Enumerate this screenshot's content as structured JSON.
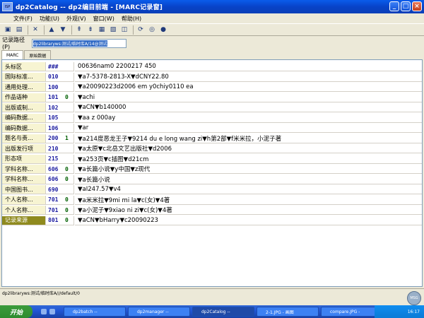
{
  "window": {
    "title": "dp2Catalog -- dp2编目前端 - [MARC记录窗]",
    "buttons": [
      "_",
      "□",
      "×"
    ]
  },
  "menu": [
    "文件(F)",
    "功能(U)",
    "外观(V)",
    "窗口(W)",
    "帮助(H)"
  ],
  "toolbar_icons": [
    "save-icon",
    "save-as-icon",
    "delete-icon",
    "prev-icon",
    "next-icon",
    "first-icon",
    "last-icon",
    "print-icon",
    "load-template-icon",
    "load-icon",
    "refresh-icon",
    "search-icon",
    "stop-icon"
  ],
  "path": {
    "label": "记录路径(P)",
    "value": "dp2libraryws:测试/临时库A/14@测试"
  },
  "tabs": [
    "MARC",
    "原始数据"
  ],
  "fields": [
    {
      "name": "头标区",
      "tag": "###",
      "ind": "",
      "value": "00636nam0 2200217   450"
    },
    {
      "name": "国际标准...",
      "tag": "010",
      "ind": "",
      "value": "▼a7-5378-2813-X▼dCNY22.80"
    },
    {
      "name": "通用处理...",
      "tag": "100",
      "ind": "",
      "value": "▼a20090223d2006    em y0chiy0110    ea"
    },
    {
      "name": "作品语种",
      "tag": "101",
      "ind": "0",
      "value": "▼achi"
    },
    {
      "name": "出版或制...",
      "tag": "102",
      "ind": "",
      "value": "▼aCN▼b140000"
    },
    {
      "name": "编码数据...",
      "tag": "105",
      "ind": "",
      "value": "▼aa  z   000ay"
    },
    {
      "name": "编码数据...",
      "tag": "106",
      "ind": "",
      "value": "▼ar"
    },
    {
      "name": "题名与责...",
      "tag": "200",
      "ind": "1",
      "value": "▼a214度恶龙王子▼9214 du e long wang zi▼h第2部▼f米米拉，小泥子著"
    },
    {
      "name": "出版发行项",
      "tag": "210",
      "ind": "",
      "value": "▼a太原▼c北岳文艺出版社▼d2006"
    },
    {
      "name": "形态项",
      "tag": "215",
      "ind": "",
      "value": "▼a253页▼c插图▼d21cm"
    },
    {
      "name": "学科名称...",
      "tag": "606",
      "ind": "0",
      "value": "▼a长篇小说▼y中国▼z现代"
    },
    {
      "name": "学科名称...",
      "tag": "606",
      "ind": "0",
      "value": "▼a长篇小说"
    },
    {
      "name": "中国图书...",
      "tag": "690",
      "ind": "",
      "value": "▼aI247.57▼v4"
    },
    {
      "name": "个人名称...",
      "tag": "701",
      "ind": "0",
      "value": "▼a米米拉▼9mi mi la▼c(女)▼4著"
    },
    {
      "name": "个人名称...",
      "tag": "701",
      "ind": "0",
      "value": "▼a小泥子▼9xiao ni zi▼c(女)▼4著"
    },
    {
      "name": "记录来源",
      "tag": "801",
      "ind": "0",
      "value": "▼aCN▼bHarry▼c20090223"
    }
  ],
  "status": "dp2libraryws:测试/临时库A///default/0",
  "taskbar": {
    "start": "开始",
    "tasks": [
      "dp2batch --",
      "dp2manager --",
      "dp2Catalog --",
      "2-1.JPG - 画图",
      "compare.JPG -"
    ],
    "clock": "16:17",
    "badge": "MSG"
  }
}
